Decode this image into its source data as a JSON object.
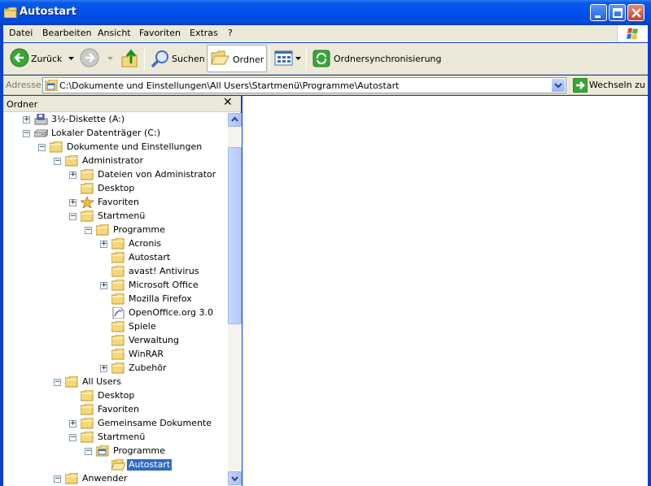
{
  "window": {
    "title": "Autostart",
    "controls": [
      "minimize-icon",
      "maximize-icon",
      "close-icon"
    ]
  },
  "menu": {
    "items": [
      "Datei",
      "Bearbeiten",
      "Ansicht",
      "Favoriten",
      "Extras",
      "?"
    ]
  },
  "toolbar": {
    "back_label": "Zurück",
    "search_label": "Suchen",
    "folders_label": "Ordner",
    "sync_label": "Ordnersynchronisierung"
  },
  "address": {
    "label": "Adresse",
    "path": "C:\\Dokumente und Einstellungen\\All Users\\Startmenü\\Programme\\Autostart",
    "go_label": "Wechseln zu"
  },
  "folder_pane": {
    "title": "Ordner",
    "close": "✕"
  },
  "tree": [
    {
      "label": "3½-Diskette (A:)",
      "icon": "floppy-drive-icon",
      "expander": "+",
      "level": 0
    },
    {
      "label": "Lokaler Datenträger (C:)",
      "icon": "hard-drive-icon",
      "expander": "−",
      "level": 0
    },
    {
      "label": "Dokumente und Einstellungen",
      "icon": "folder-icon",
      "expander": "−",
      "level": 1
    },
    {
      "label": "Administrator",
      "icon": "folder-icon",
      "expander": "−",
      "level": 2
    },
    {
      "label": "Dateien von Administrator",
      "icon": "folder-icon",
      "expander": "+",
      "level": 3
    },
    {
      "label": "Desktop",
      "icon": "folder-icon",
      "expander": "",
      "level": 3
    },
    {
      "label": "Favoriten",
      "icon": "favorites-star-icon",
      "expander": "+",
      "level": 3
    },
    {
      "label": "Startmenü",
      "icon": "folder-icon",
      "expander": "−",
      "level": 3
    },
    {
      "label": "Programme",
      "icon": "folder-icon",
      "expander": "−",
      "level": 4
    },
    {
      "label": "Acronis",
      "icon": "folder-icon",
      "expander": "+",
      "level": 5
    },
    {
      "label": "Autostart",
      "icon": "folder-icon",
      "expander": "",
      "level": 5
    },
    {
      "label": "avast! Antivirus",
      "icon": "folder-icon",
      "expander": "",
      "level": 5
    },
    {
      "label": "Microsoft Office",
      "icon": "folder-icon",
      "expander": "+",
      "level": 5
    },
    {
      "label": "Mozilla Firefox",
      "icon": "folder-icon",
      "expander": "",
      "level": 5
    },
    {
      "label": "OpenOffice.org 3.0",
      "icon": "openoffice-icon",
      "expander": "",
      "level": 5
    },
    {
      "label": "Spiele",
      "icon": "folder-icon",
      "expander": "",
      "level": 5
    },
    {
      "label": "Verwaltung",
      "icon": "folder-icon",
      "expander": "",
      "level": 5
    },
    {
      "label": "WinRAR",
      "icon": "folder-icon",
      "expander": "",
      "level": 5
    },
    {
      "label": "Zubehör",
      "icon": "folder-icon",
      "expander": "+",
      "level": 5
    },
    {
      "label": "All Users",
      "icon": "folder-icon",
      "expander": "−",
      "level": 2
    },
    {
      "label": "Desktop",
      "icon": "folder-icon",
      "expander": "",
      "level": 3
    },
    {
      "label": "Favoriten",
      "icon": "folder-icon",
      "expander": "",
      "level": 3
    },
    {
      "label": "Gemeinsame Dokumente",
      "icon": "folder-icon",
      "expander": "+",
      "level": 3
    },
    {
      "label": "Startmenü",
      "icon": "folder-icon",
      "expander": "−",
      "level": 3
    },
    {
      "label": "Programme",
      "icon": "program-folder-icon",
      "expander": "−",
      "level": 4
    },
    {
      "label": "Autostart",
      "icon": "folder-open-icon",
      "expander": "",
      "level": 5,
      "selected": true
    },
    {
      "label": "Anwender",
      "icon": "folder-icon",
      "expander": "−",
      "level": 2
    }
  ]
}
